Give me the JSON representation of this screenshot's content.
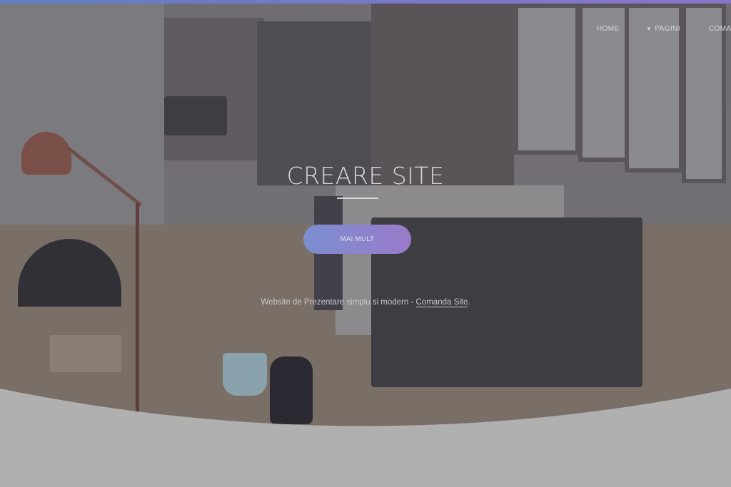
{
  "nav": {
    "items": [
      {
        "label": "HOME",
        "has_dropdown": false
      },
      {
        "label": "PAGINI",
        "has_dropdown": true
      },
      {
        "label": "COMAND",
        "has_dropdown": false
      }
    ]
  },
  "hero": {
    "title": "CREARE SITE",
    "button_label": "MAI MULT",
    "tagline_text": "Website de Prezentare simplu si modern - ",
    "tagline_link": "Comanda Site",
    "tagline_end": "."
  },
  "icons": {
    "dropdown": "chevron-down-icon"
  },
  "colors": {
    "accent_start": "#7b8fd0",
    "accent_end": "#9a7ac9",
    "overlay": "#707078",
    "lower_section": "#b0b0b0"
  }
}
